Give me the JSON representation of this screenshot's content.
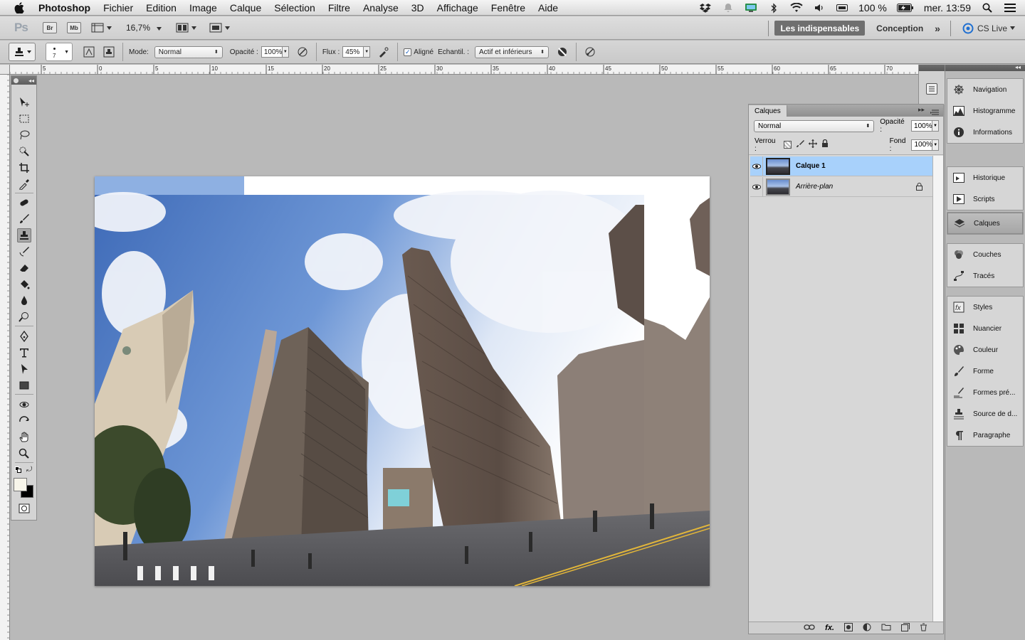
{
  "menubar": {
    "app_name": "Photoshop",
    "items": [
      "Fichier",
      "Edition",
      "Image",
      "Calque",
      "Sélection",
      "Filtre",
      "Analyse",
      "3D",
      "Affichage",
      "Fenêtre",
      "Aide"
    ],
    "battery": "100 %",
    "clock": "mer. 13:59"
  },
  "appbar": {
    "logo": "Ps",
    "bridge_label": "Br",
    "minibridge_label": "Mb",
    "zoom": "16,7%",
    "workspaces": [
      "Les indispensables",
      "Conception"
    ],
    "cs_live": "CS Live"
  },
  "options": {
    "brush_size": "7",
    "mode_label": "Mode:",
    "mode_value": "Normal",
    "opacity_label": "Opacité :",
    "opacity_value": "100%",
    "flux_label": "Flux :",
    "flux_value": "45%",
    "aligned_label": "Aligné",
    "aligned_checked": true,
    "sample_label": "Echantil. :",
    "sample_value": "Actif et inférieurs"
  },
  "ruler": {
    "ticks": [
      "5",
      "0",
      "5",
      "10",
      "15",
      "20",
      "25",
      "30",
      "35",
      "40",
      "45",
      "50",
      "55",
      "60",
      "65",
      "70"
    ]
  },
  "layers_panel": {
    "tab_label": "Calques",
    "blend_mode": "Normal",
    "opacity_label": "Opacité :",
    "opacity_value": "100%",
    "lock_label": "Verrou :",
    "fill_label": "Fond :",
    "fill_value": "100%",
    "layers": [
      {
        "name": "Calque 1",
        "selected": true,
        "locked": false
      },
      {
        "name": "Arrière-plan",
        "selected": false,
        "locked": true
      }
    ]
  },
  "dock": {
    "groups": [
      [
        "Navigation",
        "Histogramme",
        "Informations"
      ],
      [
        "Historique",
        "Scripts"
      ],
      [
        "Calques"
      ],
      [
        "Couches",
        "Tracés"
      ],
      [
        "Styles",
        "Nuancier",
        "Couleur",
        "Forme",
        "Formes pré...",
        "Source de d...",
        "Paragraphe"
      ]
    ]
  },
  "colors": {
    "selected_layer": "#a8d1fb",
    "sky": "#5a84c9"
  }
}
